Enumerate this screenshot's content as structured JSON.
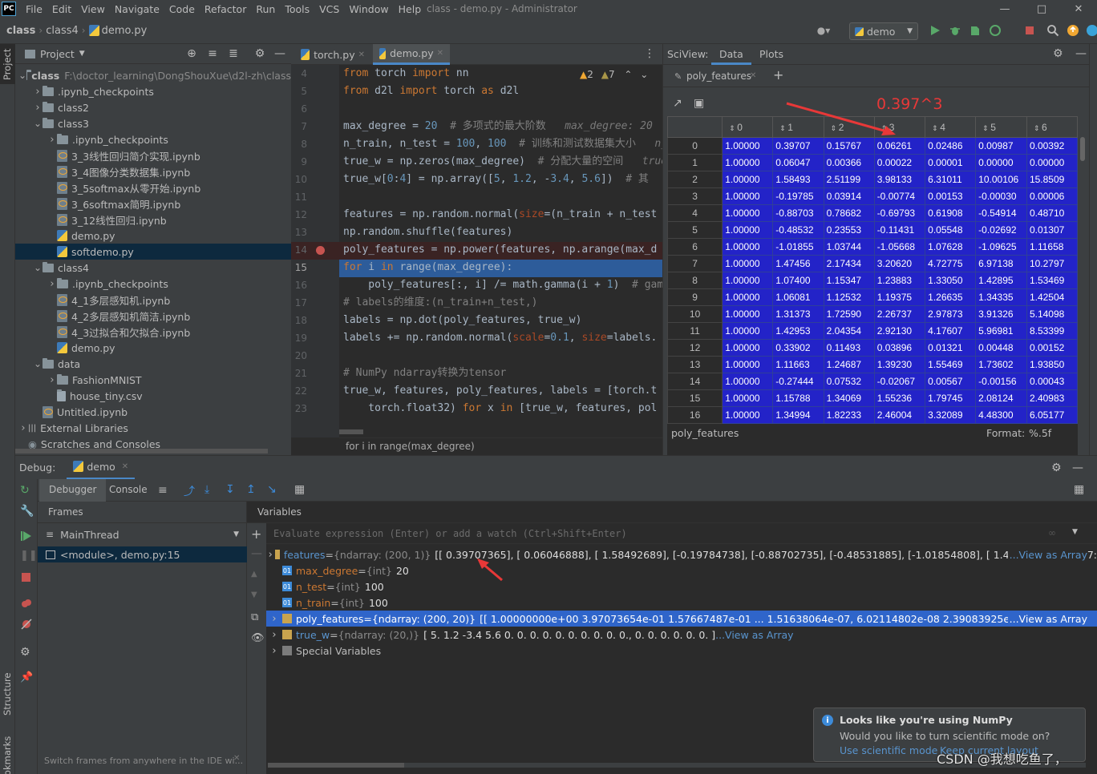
{
  "menubar": {
    "app_icon": "PC",
    "items": [
      "File",
      "Edit",
      "View",
      "Navigate",
      "Code",
      "Refactor",
      "Run",
      "Tools",
      "VCS",
      "Window",
      "Help"
    ],
    "title": "class - demo.py - Administrator"
  },
  "breadcrumb": [
    "class",
    "class4",
    "demo.py"
  ],
  "run_config": "demo",
  "project": {
    "header": "Project",
    "rows": [
      {
        "label": "class",
        "path": "F:\\doctor_learning\\DongShouXue\\d2l-zh\\class",
        "type": "folder",
        "arrow": "open",
        "bold": true
      },
      {
        "label": ".ipynb_checkpoints",
        "type": "folder",
        "arrow": "closed"
      },
      {
        "label": "class2",
        "type": "folder",
        "arrow": "closed"
      },
      {
        "label": "class3",
        "type": "folder",
        "arrow": "open"
      },
      {
        "label": ".ipynb_checkpoints",
        "type": "folder",
        "arrow": "closed"
      },
      {
        "label": "3_3线性回归简介实现.ipynb",
        "type": "ipynb"
      },
      {
        "label": "3_4图像分类数据集.ipynb",
        "type": "ipynb"
      },
      {
        "label": "3_5softmax从零开始.ipynb",
        "type": "ipynb"
      },
      {
        "label": "3_6softmax简明.ipynb",
        "type": "ipynb"
      },
      {
        "label": "3_12线性回归.ipynb",
        "type": "ipynb"
      },
      {
        "label": "demo.py",
        "type": "py"
      },
      {
        "label": "softdemo.py",
        "type": "py",
        "selected": true
      },
      {
        "label": "class4",
        "type": "folder",
        "arrow": "open"
      },
      {
        "label": ".ipynb_checkpoints",
        "type": "folder",
        "arrow": "closed"
      },
      {
        "label": "4_1多层感知机.ipynb",
        "type": "ipynb"
      },
      {
        "label": "4_2多层感知机简洁.ipynb",
        "type": "ipynb"
      },
      {
        "label": "4_3过拟合和欠拟合.ipynb",
        "type": "ipynb"
      },
      {
        "label": "demo.py",
        "type": "py"
      },
      {
        "label": "data",
        "type": "folder",
        "arrow": "open"
      },
      {
        "label": "FashionMNIST",
        "type": "folder",
        "arrow": "closed"
      },
      {
        "label": "house_tiny.csv",
        "type": "csv"
      },
      {
        "label": "Untitled.ipynb",
        "type": "ipynb"
      },
      {
        "label": "External Libraries",
        "type": "lib",
        "arrow": "closed"
      },
      {
        "label": "Scratches and Consoles",
        "type": "scratch"
      }
    ]
  },
  "editor": {
    "tabs": [
      {
        "label": "torch.py",
        "active": false
      },
      {
        "label": "demo.py",
        "active": true
      }
    ],
    "inspection": {
      "warnings": "2",
      "weak": "7"
    },
    "line_numbers": [
      "4",
      "5",
      "6",
      "7",
      "8",
      "9",
      "10",
      "11",
      "12",
      "13",
      "14",
      "15",
      "16",
      "17",
      "18",
      "19",
      "20",
      "21",
      "22",
      "23"
    ],
    "footer": "for i in range(max_degree)"
  },
  "sciview": {
    "title": "SciView:",
    "tabs": [
      "Data",
      "Plots"
    ],
    "data_tab": "poly_features",
    "annotation": "0.397^3",
    "columns": [
      "0",
      "1",
      "2",
      "3",
      "4",
      "5",
      "6"
    ],
    "rows": [
      [
        "0",
        "1.00000",
        "0.39707",
        "0.15767",
        "0.06261",
        "0.02486",
        "0.00987",
        "0.00392"
      ],
      [
        "1",
        "1.00000",
        "0.06047",
        "0.00366",
        "0.00022",
        "0.00001",
        "0.00000",
        "0.00000"
      ],
      [
        "2",
        "1.00000",
        "1.58493",
        "2.51199",
        "3.98133",
        "6.31011",
        "10.00106",
        "15.8509"
      ],
      [
        "3",
        "1.00000",
        "-0.19785",
        "0.03914",
        "-0.00774",
        "0.00153",
        "-0.00030",
        "0.00006"
      ],
      [
        "4",
        "1.00000",
        "-0.88703",
        "0.78682",
        "-0.69793",
        "0.61908",
        "-0.54914",
        "0.48710"
      ],
      [
        "5",
        "1.00000",
        "-0.48532",
        "0.23553",
        "-0.11431",
        "0.05548",
        "-0.02692",
        "0.01307"
      ],
      [
        "6",
        "1.00000",
        "-1.01855",
        "1.03744",
        "-1.05668",
        "1.07628",
        "-1.09625",
        "1.11658"
      ],
      [
        "7",
        "1.00000",
        "1.47456",
        "2.17434",
        "3.20620",
        "4.72775",
        "6.97138",
        "10.2797"
      ],
      [
        "8",
        "1.00000",
        "1.07400",
        "1.15347",
        "1.23883",
        "1.33050",
        "1.42895",
        "1.53469"
      ],
      [
        "9",
        "1.00000",
        "1.06081",
        "1.12532",
        "1.19375",
        "1.26635",
        "1.34335",
        "1.42504"
      ],
      [
        "10",
        "1.00000",
        "1.31373",
        "1.72590",
        "2.26737",
        "2.97873",
        "3.91326",
        "5.14098"
      ],
      [
        "11",
        "1.00000",
        "1.42953",
        "2.04354",
        "2.92130",
        "4.17607",
        "5.96981",
        "8.53399"
      ],
      [
        "12",
        "1.00000",
        "0.33902",
        "0.11493",
        "0.03896",
        "0.01321",
        "0.00448",
        "0.00152"
      ],
      [
        "13",
        "1.00000",
        "1.11663",
        "1.24687",
        "1.39230",
        "1.55469",
        "1.73602",
        "1.93850"
      ],
      [
        "14",
        "1.00000",
        "-0.27444",
        "0.07532",
        "-0.02067",
        "0.00567",
        "-0.00156",
        "0.00043"
      ],
      [
        "15",
        "1.00000",
        "1.15788",
        "1.34069",
        "1.55236",
        "1.79745",
        "2.08124",
        "2.40983"
      ],
      [
        "16",
        "1.00000",
        "1.34994",
        "1.82233",
        "2.46004",
        "3.32089",
        "4.48300",
        "6.05177"
      ]
    ],
    "footer_name": "poly_features",
    "format_label": "Format:",
    "format_value": "%.5f"
  },
  "debug": {
    "label": "Debug:",
    "session": "demo",
    "tabs": [
      "Debugger",
      "Console"
    ],
    "frames_header": "Frames",
    "variables_header": "Variables",
    "thread": "MainThread",
    "frame": "<module>, demo.py:15",
    "frames_hint": "Switch frames from anywhere in the IDE wi...",
    "eval_placeholder": "Evaluate expression (Enter) or add a watch (Ctrl+Shift+Enter)",
    "variables": [
      {
        "name": "features",
        "type": "{ndarray: (200, 1)}",
        "value": "[[ 0.39707365], [ 0.06046888], [ 1.58492689], [-0.19784738], [-0.88702735], [-0.48531885], [-1.01854808], [ 1.47456428], [ 1.07:",
        "link": "...View as Array",
        "expandable": true,
        "icon": "array"
      },
      {
        "name": "max_degree",
        "type": "{int}",
        "value": "20",
        "expandable": false,
        "icon": "01"
      },
      {
        "name": "n_test",
        "type": "{int}",
        "value": "100",
        "expandable": false,
        "icon": "01"
      },
      {
        "name": "n_train",
        "type": "{int}",
        "value": "100",
        "expandable": false,
        "icon": "01"
      },
      {
        "name": "poly_features",
        "type": "{ndarray: (200, 20)}",
        "value": "[[ 1.00000000e+00  3.97073654e-01  1.57667487e-01 ...  1.51638064e-07,  6.02114802e-08  2.39083925e-08], [ 1.0000",
        "link": "...View as Array",
        "expandable": true,
        "icon": "array",
        "selected": true
      },
      {
        "name": "true_w",
        "type": "{ndarray: (20,)}",
        "value": "[ 5.   1.2 -3.4  5.6  0.   0.   0.   0.   0.   0.   0.   0.   0.   0.,  0.   0.   0.   0.   0.   0. ]",
        "link": "...View as Array",
        "expandable": true,
        "icon": "array"
      },
      {
        "name": "Special Variables",
        "type": "",
        "value": "",
        "expandable": true,
        "icon": "special"
      }
    ]
  },
  "left_stripe": {
    "project": "Project",
    "structure": "Structure",
    "bookmarks": "Bookmarks"
  },
  "notification": {
    "title": "Looks like you're using NumPy",
    "body": "Would you like to turn scientific mode on?",
    "action1": "Use scientific mode",
    "action2": "Keep current layout"
  },
  "watermark": "CSDN @我想吃鱼了，",
  "colors": {
    "accent": "#4a88c7",
    "selection": "#2f65ca",
    "grid_cell": "#2323c8",
    "annotation": "#e83838"
  }
}
